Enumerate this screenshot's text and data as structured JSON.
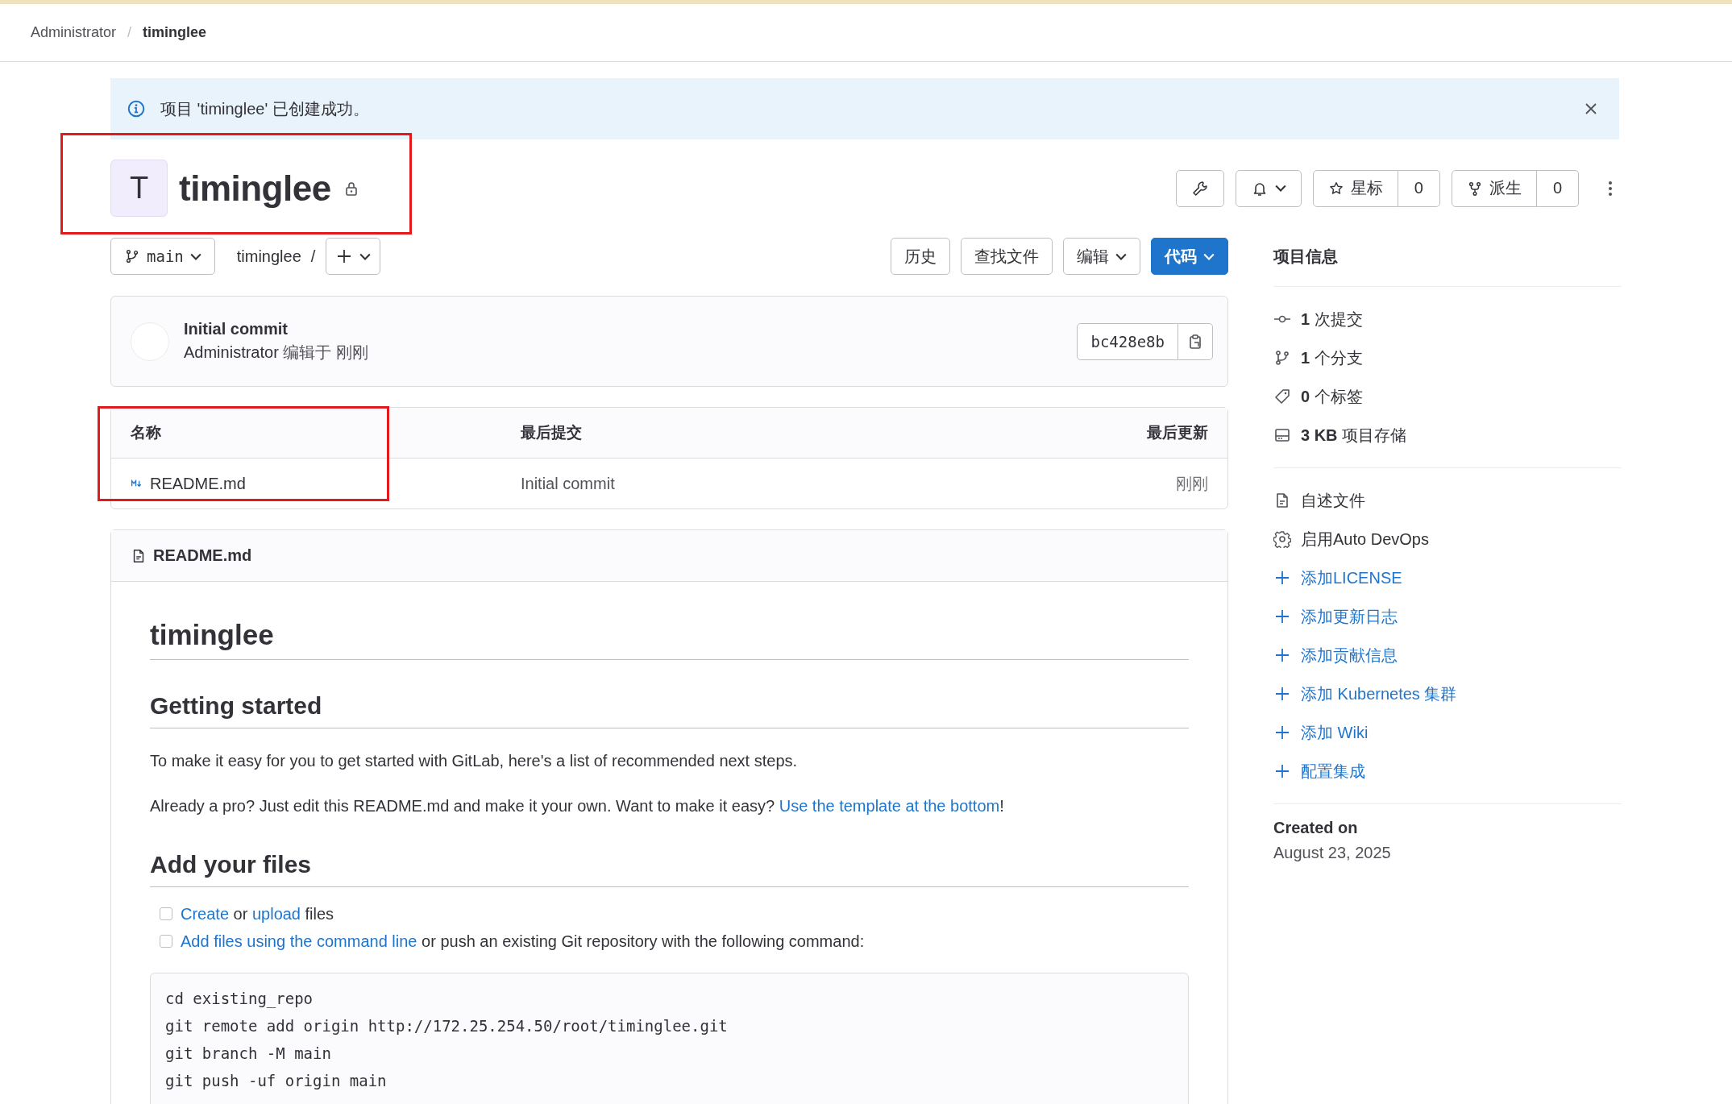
{
  "breadcrumb": {
    "separator": "/",
    "items": [
      {
        "label": "Administrator",
        "current": false
      },
      {
        "label": "timinglee",
        "current": true
      }
    ]
  },
  "alert": {
    "text": "项目 'timinglee' 已创建成功。"
  },
  "project": {
    "avatar_letter": "T",
    "name": "timinglee",
    "private": true,
    "highlighted": true
  },
  "actions": {
    "star": {
      "label": "星标",
      "count": "0"
    },
    "fork": {
      "label": "派生",
      "count": "0"
    }
  },
  "repo_nav": {
    "branch": "main",
    "path": "timinglee",
    "separator": "/"
  },
  "buttons": [
    {
      "label": "历史",
      "kind": "plain"
    },
    {
      "label": "查找文件",
      "kind": "plain"
    },
    {
      "label": "编辑",
      "kind": "dropdown"
    },
    {
      "label": "代码",
      "kind": "primary"
    }
  ],
  "last_commit": {
    "title": "Initial commit",
    "author": "Administrator",
    "meta": "编辑于 刚刚",
    "sha": "bc428e8b"
  },
  "file_table": {
    "columns": [
      {
        "label": "名称",
        "highlighted": true
      },
      {
        "label": "最后提交",
        "highlighted": false
      },
      {
        "label": "最后更新",
        "highlighted": false
      }
    ],
    "rows": [
      {
        "name": "README.md",
        "commit": "Initial commit",
        "updated": "刚刚"
      }
    ]
  },
  "readme": {
    "filename": "README.md",
    "blocks": [
      {
        "kind": "h1",
        "parts": [
          {
            "text": "timinglee",
            "link": false
          }
        ]
      },
      {
        "kind": "h2",
        "parts": [
          {
            "text": "Getting started",
            "link": false
          }
        ]
      },
      {
        "kind": "p",
        "parts": [
          {
            "text": "To make it easy for you to get started with GitLab, here's a list of recommended next steps.",
            "link": false
          }
        ]
      },
      {
        "kind": "p",
        "parts": [
          {
            "text": "Already a pro? Just edit this README.md and make it your own. Want to make it easy? ",
            "link": false
          },
          {
            "text": "Use the template at the bottom",
            "link": true
          },
          {
            "text": "!",
            "link": false
          }
        ]
      },
      {
        "kind": "h2",
        "parts": [
          {
            "text": "Add your files",
            "link": false
          }
        ]
      },
      {
        "kind": "task",
        "checked": false,
        "parts": [
          {
            "text": "Create",
            "link": true
          },
          {
            "text": " or ",
            "link": false
          },
          {
            "text": "upload",
            "link": true
          },
          {
            "text": " files",
            "link": false
          }
        ]
      },
      {
        "kind": "task",
        "checked": false,
        "parts": [
          {
            "text": "Add files using the command line",
            "link": true
          },
          {
            "text": " or push an existing Git repository with the following command:",
            "link": false
          }
        ]
      },
      {
        "kind": "code",
        "lines": [
          "cd existing_repo",
          "git remote add origin http://172.25.254.50/root/timinglee.git",
          "git branch -M main",
          "git push -uf origin main"
        ]
      }
    ]
  },
  "sidebar": {
    "title": "项目信息",
    "stats": [
      {
        "kind": "commit",
        "text": "**1** 次提交"
      },
      {
        "kind": "branch",
        "text": "**1** 个分支"
      },
      {
        "kind": "tag",
        "text": "**0** 个标签"
      },
      {
        "kind": "storage",
        "text": "**3 KB** 项目存储"
      }
    ],
    "links": [
      {
        "kind": "file",
        "label": "自述文件"
      },
      {
        "kind": "settings",
        "label": "启用Auto DevOps"
      },
      {
        "kind": "add",
        "label": "添加LICENSE"
      },
      {
        "kind": "add",
        "label": "添加更新日志"
      },
      {
        "kind": "add",
        "label": "添加贡献信息"
      },
      {
        "kind": "add",
        "label": "添加 Kubernetes 集群"
      },
      {
        "kind": "add",
        "label": "添加 Wiki"
      },
      {
        "kind": "add",
        "label": "配置集成"
      }
    ],
    "created": {
      "label": "Created on",
      "date": "August 23, 2025"
    }
  }
}
